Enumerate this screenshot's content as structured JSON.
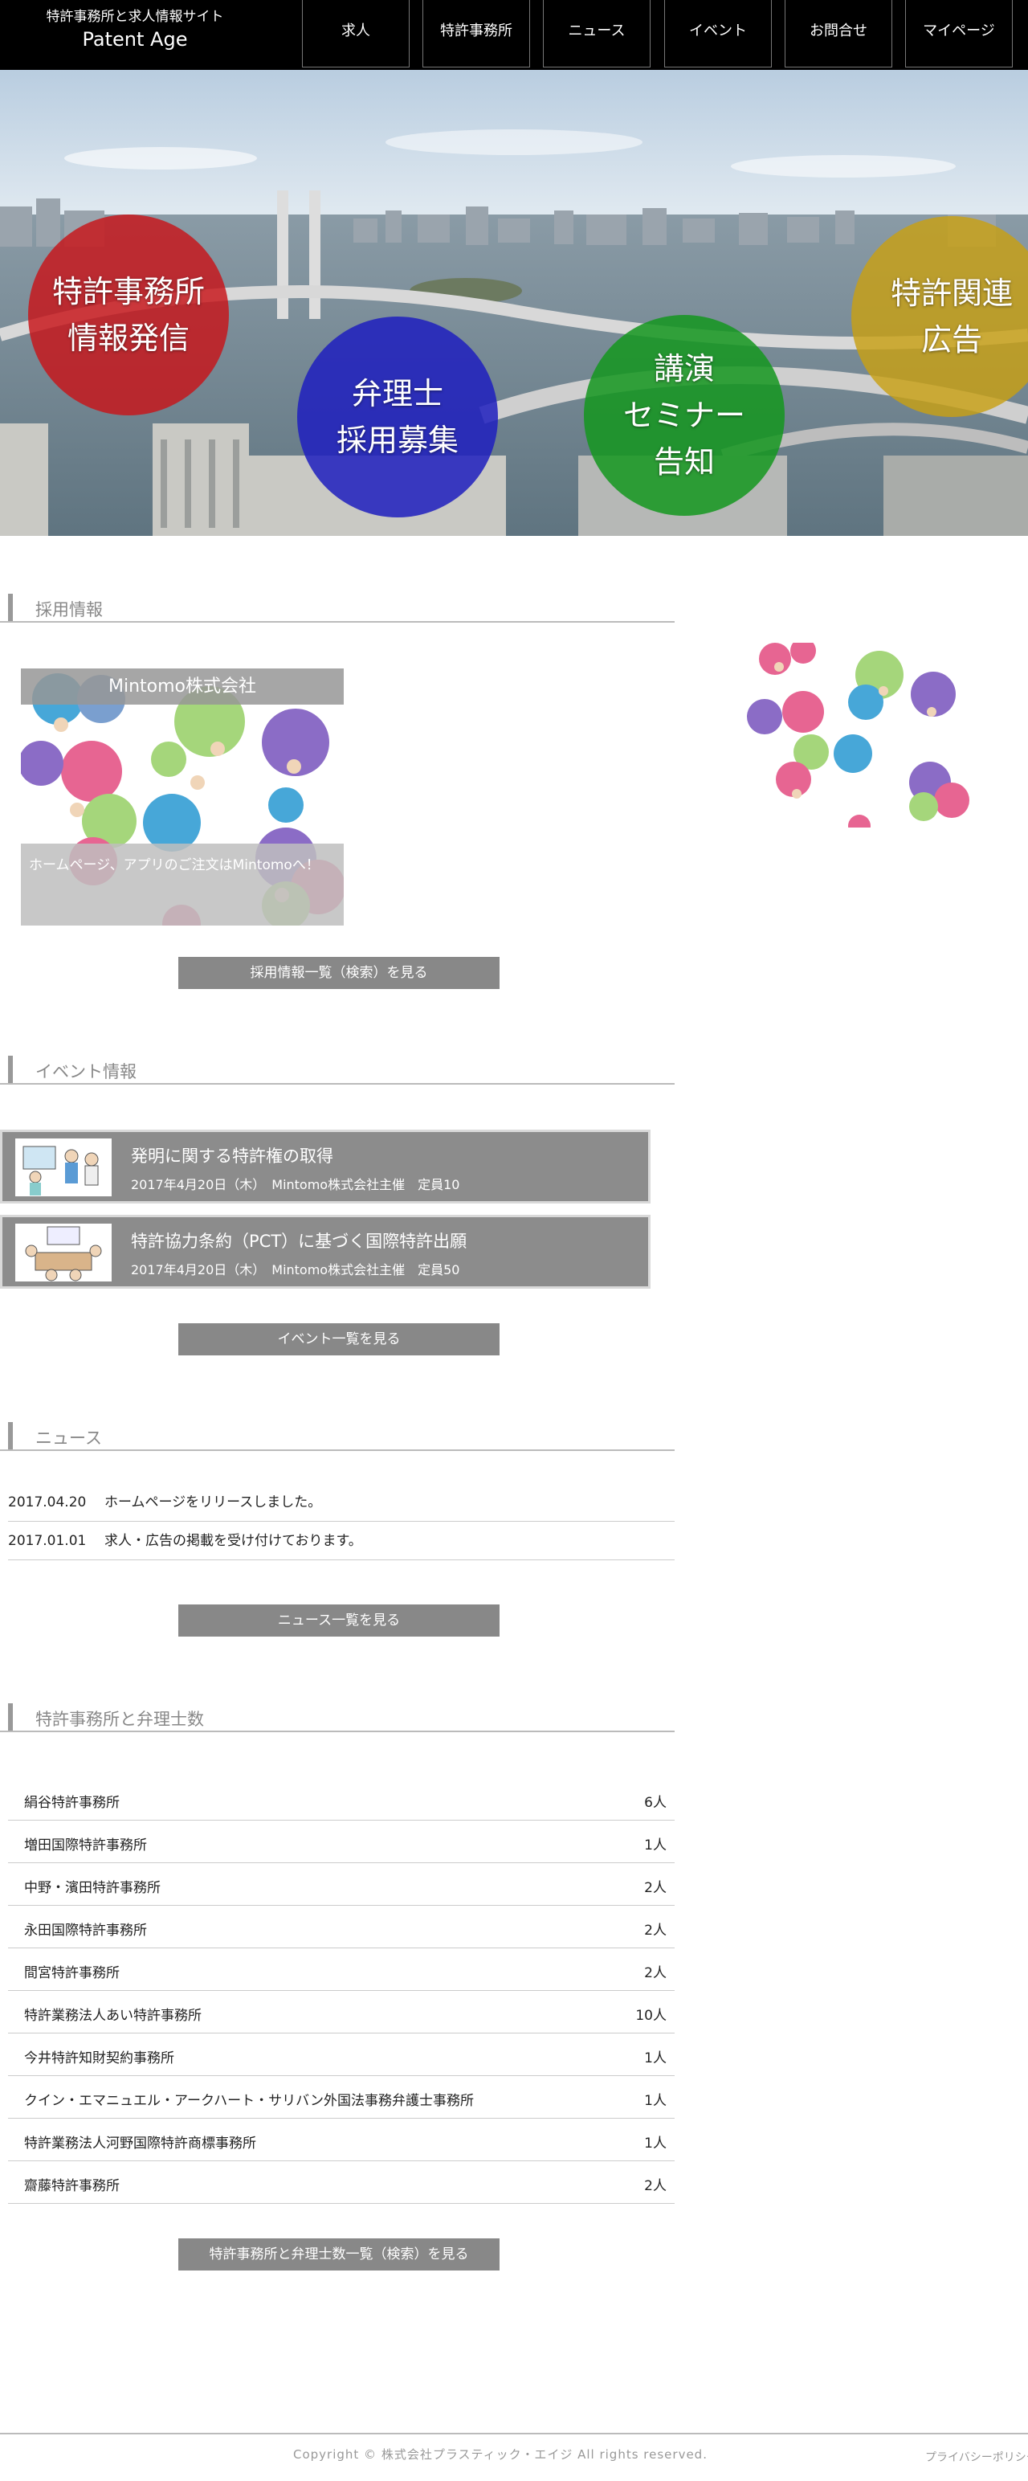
{
  "header": {
    "site_subtitle": "特許事務所と求人情報サイト",
    "site_title": "Patent Age",
    "nav": [
      "求人",
      "特許事務所",
      "ニュース",
      "イベント",
      "お問合せ",
      "マイページ"
    ]
  },
  "hero": {
    "circles": [
      {
        "line1": "特許事務所",
        "line2": "情報発信",
        "line3": ""
      },
      {
        "line1": "弁理士",
        "line2": "採用募集",
        "line3": ""
      },
      {
        "line1": "講演",
        "line2": "セミナー",
        "line3": "告知"
      },
      {
        "line1": "特許関連",
        "line2": "広告",
        "line3": ""
      }
    ]
  },
  "recruit": {
    "heading": "採用情報",
    "company": "Mintomo株式会社",
    "description": "ホームページ、アプリのご注文はMintomoへ！",
    "button": "採用情報一覧（検索）を見る"
  },
  "events": {
    "heading": "イベント情報",
    "items": [
      {
        "title": "発明に関する特許権の取得",
        "meta": "2017年4月20日（木）　Mintomo株式会社主催　定員10"
      },
      {
        "title": "特許協力条約（PCT）に基づく国際特許出願",
        "meta": "2017年4月20日（木）　Mintomo株式会社主催　定員50"
      }
    ],
    "button": "イベント一覧を見る"
  },
  "news": {
    "heading": "ニュース",
    "items": [
      {
        "date": "2017.04.20",
        "text": "ホームページをリリースしました。"
      },
      {
        "date": "2017.01.01",
        "text": "求人・広告の掲載を受け付けております。"
      }
    ],
    "button": "ニュース一覧を見る"
  },
  "firms": {
    "heading": "特許事務所と弁理士数",
    "items": [
      {
        "name": "絹谷特許事務所",
        "count": "6人"
      },
      {
        "name": "増田国際特許事務所",
        "count": "1人"
      },
      {
        "name": "中野・濱田特許事務所",
        "count": "2人"
      },
      {
        "name": "永田国際特許事務所",
        "count": "2人"
      },
      {
        "name": "間宮特許事務所",
        "count": "2人"
      },
      {
        "name": "特許業務法人あい特許事務所",
        "count": "10人"
      },
      {
        "name": "今井特許知財契約事務所",
        "count": "1人"
      },
      {
        "name": "クイン・エマニュエル・アークハート・サリバン外国法事務弁護士事務所",
        "count": "1人"
      },
      {
        "name": "特許業務法人河野国際特許商標事務所",
        "count": "1人"
      },
      {
        "name": "齋藤特許事務所",
        "count": "2人"
      }
    ],
    "button": "特許事務所と弁理士数一覧（検索）を見る"
  },
  "footer": {
    "copyright": "Copyright © 株式会社プラスティック・エイジ All rights reserved.",
    "privacy": "プライバシーポリシー"
  }
}
